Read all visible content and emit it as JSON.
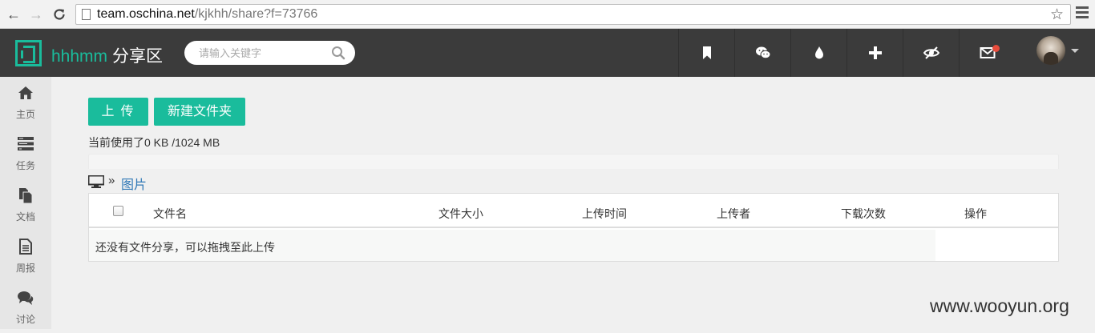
{
  "browser": {
    "url_host": "team.oschina.net",
    "url_path": "/kjkhh/share?f=73766"
  },
  "header": {
    "brand_name": "hhhmm",
    "brand_sub": "分享区",
    "search_placeholder": "请输入关键字",
    "accent_color": "#1abc9c",
    "icons": [
      "bookmark-icon",
      "wechat-icon",
      "drop-icon",
      "plus-icon",
      "eye-icon",
      "mail-icon"
    ]
  },
  "sidebar": {
    "items": [
      {
        "label": "主页",
        "icon": "home-icon"
      },
      {
        "label": "任务",
        "icon": "tasks-icon"
      },
      {
        "label": "文档",
        "icon": "documents-icon"
      },
      {
        "label": "周报",
        "icon": "report-icon"
      },
      {
        "label": "讨论",
        "icon": "discussion-icon"
      }
    ]
  },
  "main": {
    "upload_label": "上传",
    "new_folder_label": "新建文件夹",
    "usage_text": "当前使用了0 KB /1024 MB",
    "usage_fraction": 0,
    "breadcrumb": {
      "separator": "»",
      "current": "图片"
    },
    "table": {
      "columns": [
        "文件名",
        "文件大小",
        "上传时间",
        "上传者",
        "下载次数",
        "操作"
      ],
      "empty_text": "还没有文件分享，可以拖拽至此上传"
    }
  },
  "watermark": "www.wooyun.org"
}
